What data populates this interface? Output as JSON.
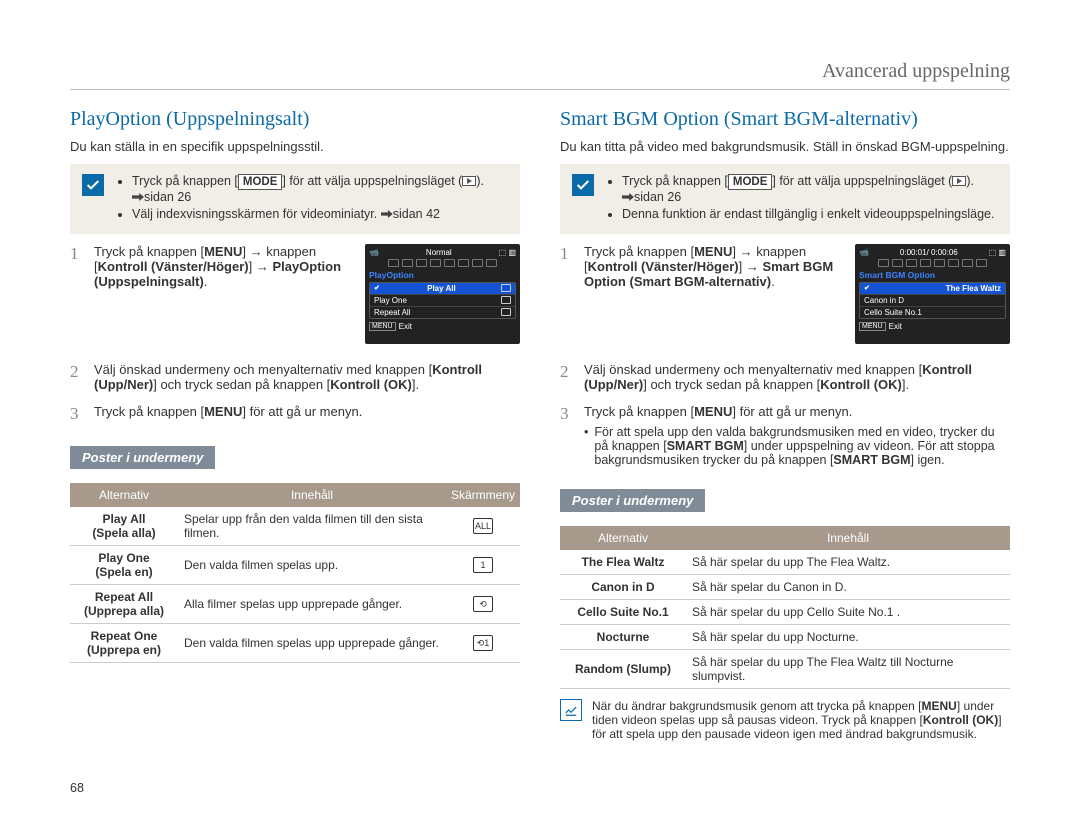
{
  "pageHeader": "Avancerad uppspelning",
  "pageNumber": "68",
  "left": {
    "heading": "PlayOption (Uppspelningsalt)",
    "intro": "Du kan ställa in en specifik uppspelningsstil.",
    "precheck": {
      "items": [
        {
          "pre": "Tryck på knappen ",
          "key": "MODE",
          "post": " för att välja uppspelningsläget (",
          "icon": true,
          "tail": ").",
          "ref": "sidan 26"
        },
        {
          "text": "Välj indexvisningsskärmen för videominiatyr. ",
          "ref": "sidan 42"
        }
      ]
    },
    "camera": {
      "topLeftIcon": "cam",
      "topRightText": "Normal",
      "title": "PlayOption",
      "selected": "Play All",
      "items": [
        {
          "label": "Play All",
          "icon": "all",
          "selected": true
        },
        {
          "label": "Play One",
          "icon": "one"
        },
        {
          "label": "Repeat All",
          "icon": "rall"
        }
      ],
      "exitKey": "MENU",
      "exitLabel": "Exit"
    },
    "steps": [
      {
        "html": "Tryck på knappen [<b>MENU</b>] → knappen [<b>Kontroll (Vänster/Höger)</b>] → <b>PlayOption (Uppspelningsalt)</b>."
      },
      {
        "html": "Välj önskad undermeny och menyalternativ med knappen [<b>Kontroll (Upp/Ner)</b>] och tryck sedan på knappen [<b>Kontroll (OK)</b>]."
      },
      {
        "html": "Tryck på knappen [<b>MENU</b>] för att gå ur menyn."
      }
    ],
    "subHeading": "Poster i undermeny",
    "table": {
      "headers": [
        "Alternativ",
        "Innehåll",
        "Skärmmeny"
      ],
      "rows": [
        {
          "name": "Play All\n(Spela alla)",
          "desc": "Spelar upp från den valda filmen till den sista filmen.",
          "glyph": "ALL"
        },
        {
          "name": "Play One\n(Spela en)",
          "desc": "Den valda filmen spelas upp.",
          "glyph": "1"
        },
        {
          "name": "Repeat All\n(Upprepa alla)",
          "desc": "Alla filmer spelas upp upprepade gånger.",
          "glyph": "⟲"
        },
        {
          "name": "Repeat One\n(Upprepa en)",
          "desc": "Den valda filmen spelas upp upprepade gånger.",
          "glyph": "⟲1"
        }
      ]
    }
  },
  "right": {
    "heading": "Smart BGM Option (Smart BGM-alternativ)",
    "intro": "Du kan titta på video med bakgrundsmusik. Ställ in önskad BGM-uppspelning.",
    "precheck": {
      "items": [
        {
          "pre": "Tryck på knappen ",
          "key": "MODE",
          "post": " för att välja uppspelningsläget (",
          "icon": true,
          "tail": ").",
          "ref": "sidan 26"
        },
        {
          "text": "Denna funktion är endast tillgänglig i enkelt videouppspelningsläge."
        }
      ]
    },
    "camera": {
      "topRightText": "0:00:01/ 0:00:06",
      "title": "Smart BGM Option",
      "items": [
        {
          "label": "The Flea Waltz",
          "selected": true
        },
        {
          "label": "Canon in D"
        },
        {
          "label": "Cello Suite No.1"
        }
      ],
      "exitKey": "MENU",
      "exitLabel": "Exit"
    },
    "steps": [
      {
        "html": "Tryck på knappen [<b>MENU</b>] → knappen [<b>Kontroll (Vänster/Höger)</b>] → <b>Smart BGM Option (Smart BGM-alternativ)</b>."
      },
      {
        "html": "Välj önskad undermeny och menyalternativ med knappen [<b>Kontroll (Upp/Ner)</b>] och tryck sedan på knappen [<b>Kontroll (OK)</b>]."
      },
      {
        "html": "Tryck på knappen [<b>MENU</b>] för att gå ur menyn.",
        "sub": "För att spela upp den valda bakgrundsmusiken med en video, trycker du på knappen [<b>SMART BGM</b>] under uppspelning av videon. För att stoppa bakgrundsmusiken trycker du på knappen [<b>SMART BGM</b>] igen."
      }
    ],
    "subHeading": "Poster i undermeny",
    "table": {
      "headers": [
        "Alternativ",
        "Innehåll"
      ],
      "rows": [
        {
          "name": "The Flea Waltz",
          "desc": "Så här spelar du upp The Flea Waltz."
        },
        {
          "name": "Canon in D",
          "desc": "Så här spelar du Canon in D."
        },
        {
          "name": "Cello Suite No.1",
          "desc": "Så här spelar du upp Cello Suite No.1 ."
        },
        {
          "name": "Nocturne",
          "desc": "Så här spelar du upp Nocturne."
        },
        {
          "name": "Random (Slump)",
          "desc": "Så här spelar du upp The Flea Waltz till Nocturne slumpvist."
        }
      ]
    },
    "note": "När du ändrar bakgrundsmusik genom att trycka på knappen [<b>MENU</b>] under tiden videon spelas upp så pausas videon. Tryck på knappen [<b>Kontroll (OK)</b>] för att spela upp den pausade videon igen med ändrad bakgrundsmusik."
  }
}
